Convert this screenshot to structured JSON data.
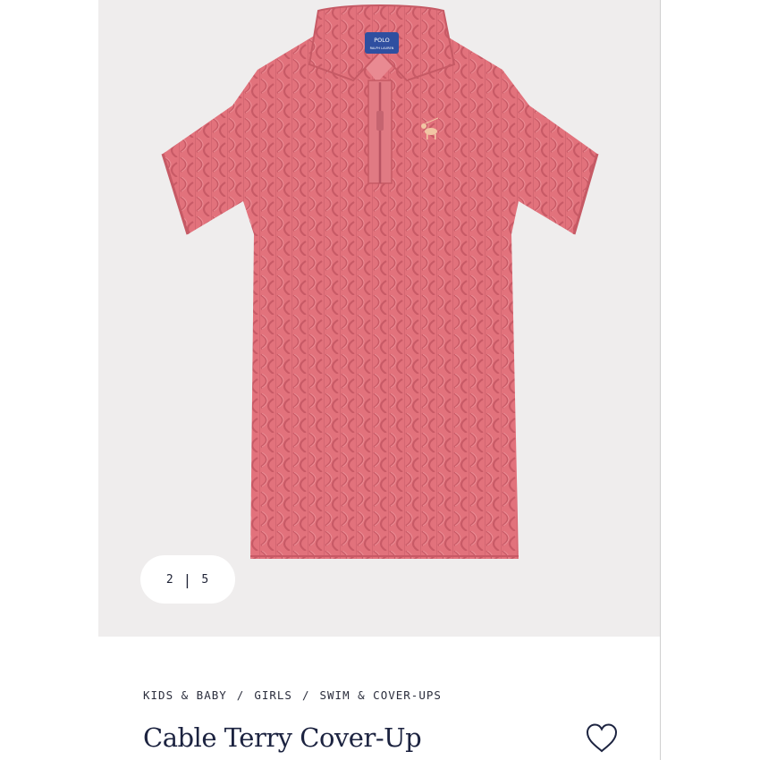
{
  "gallery": {
    "current": "2",
    "separator": "|",
    "total": "5",
    "logo_text": "POLO",
    "logo_subtext": "RALPH LAUREN"
  },
  "breadcrumb": [
    "KIDS & BABY",
    "GIRLS",
    "SWIM & COVER-UPS"
  ],
  "breadcrumb_separator": "/",
  "product": {
    "title": "Cable Terry Cover-Up"
  },
  "icons": {
    "favorite": "heart-outline-icon"
  },
  "colors": {
    "image_background": "#efeded",
    "garment": "#e0707a",
    "text_primary": "#1c2340"
  }
}
